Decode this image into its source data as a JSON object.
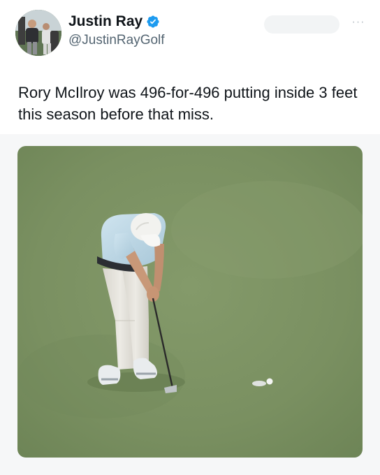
{
  "author": {
    "display_name": "Justin Ray",
    "handle": "@JustinRayGolf",
    "verified": true,
    "avatar_icon": "avatar-photo",
    "verified_icon": "verified-badge-icon",
    "verified_color": "#1d9bf0"
  },
  "header_actions": {
    "more_label": "···",
    "more_icon": "more-options-icon"
  },
  "tweet": {
    "text": "Rory McIlroy was 496-for-496 putting inside 3 feet this season before that miss."
  },
  "media": {
    "type": "photo",
    "subject": "golfer-putting-on-green",
    "colors": {
      "green": "#7d9364",
      "shirt": "#bcd8e8",
      "pants": "#e4e2dc"
    }
  }
}
